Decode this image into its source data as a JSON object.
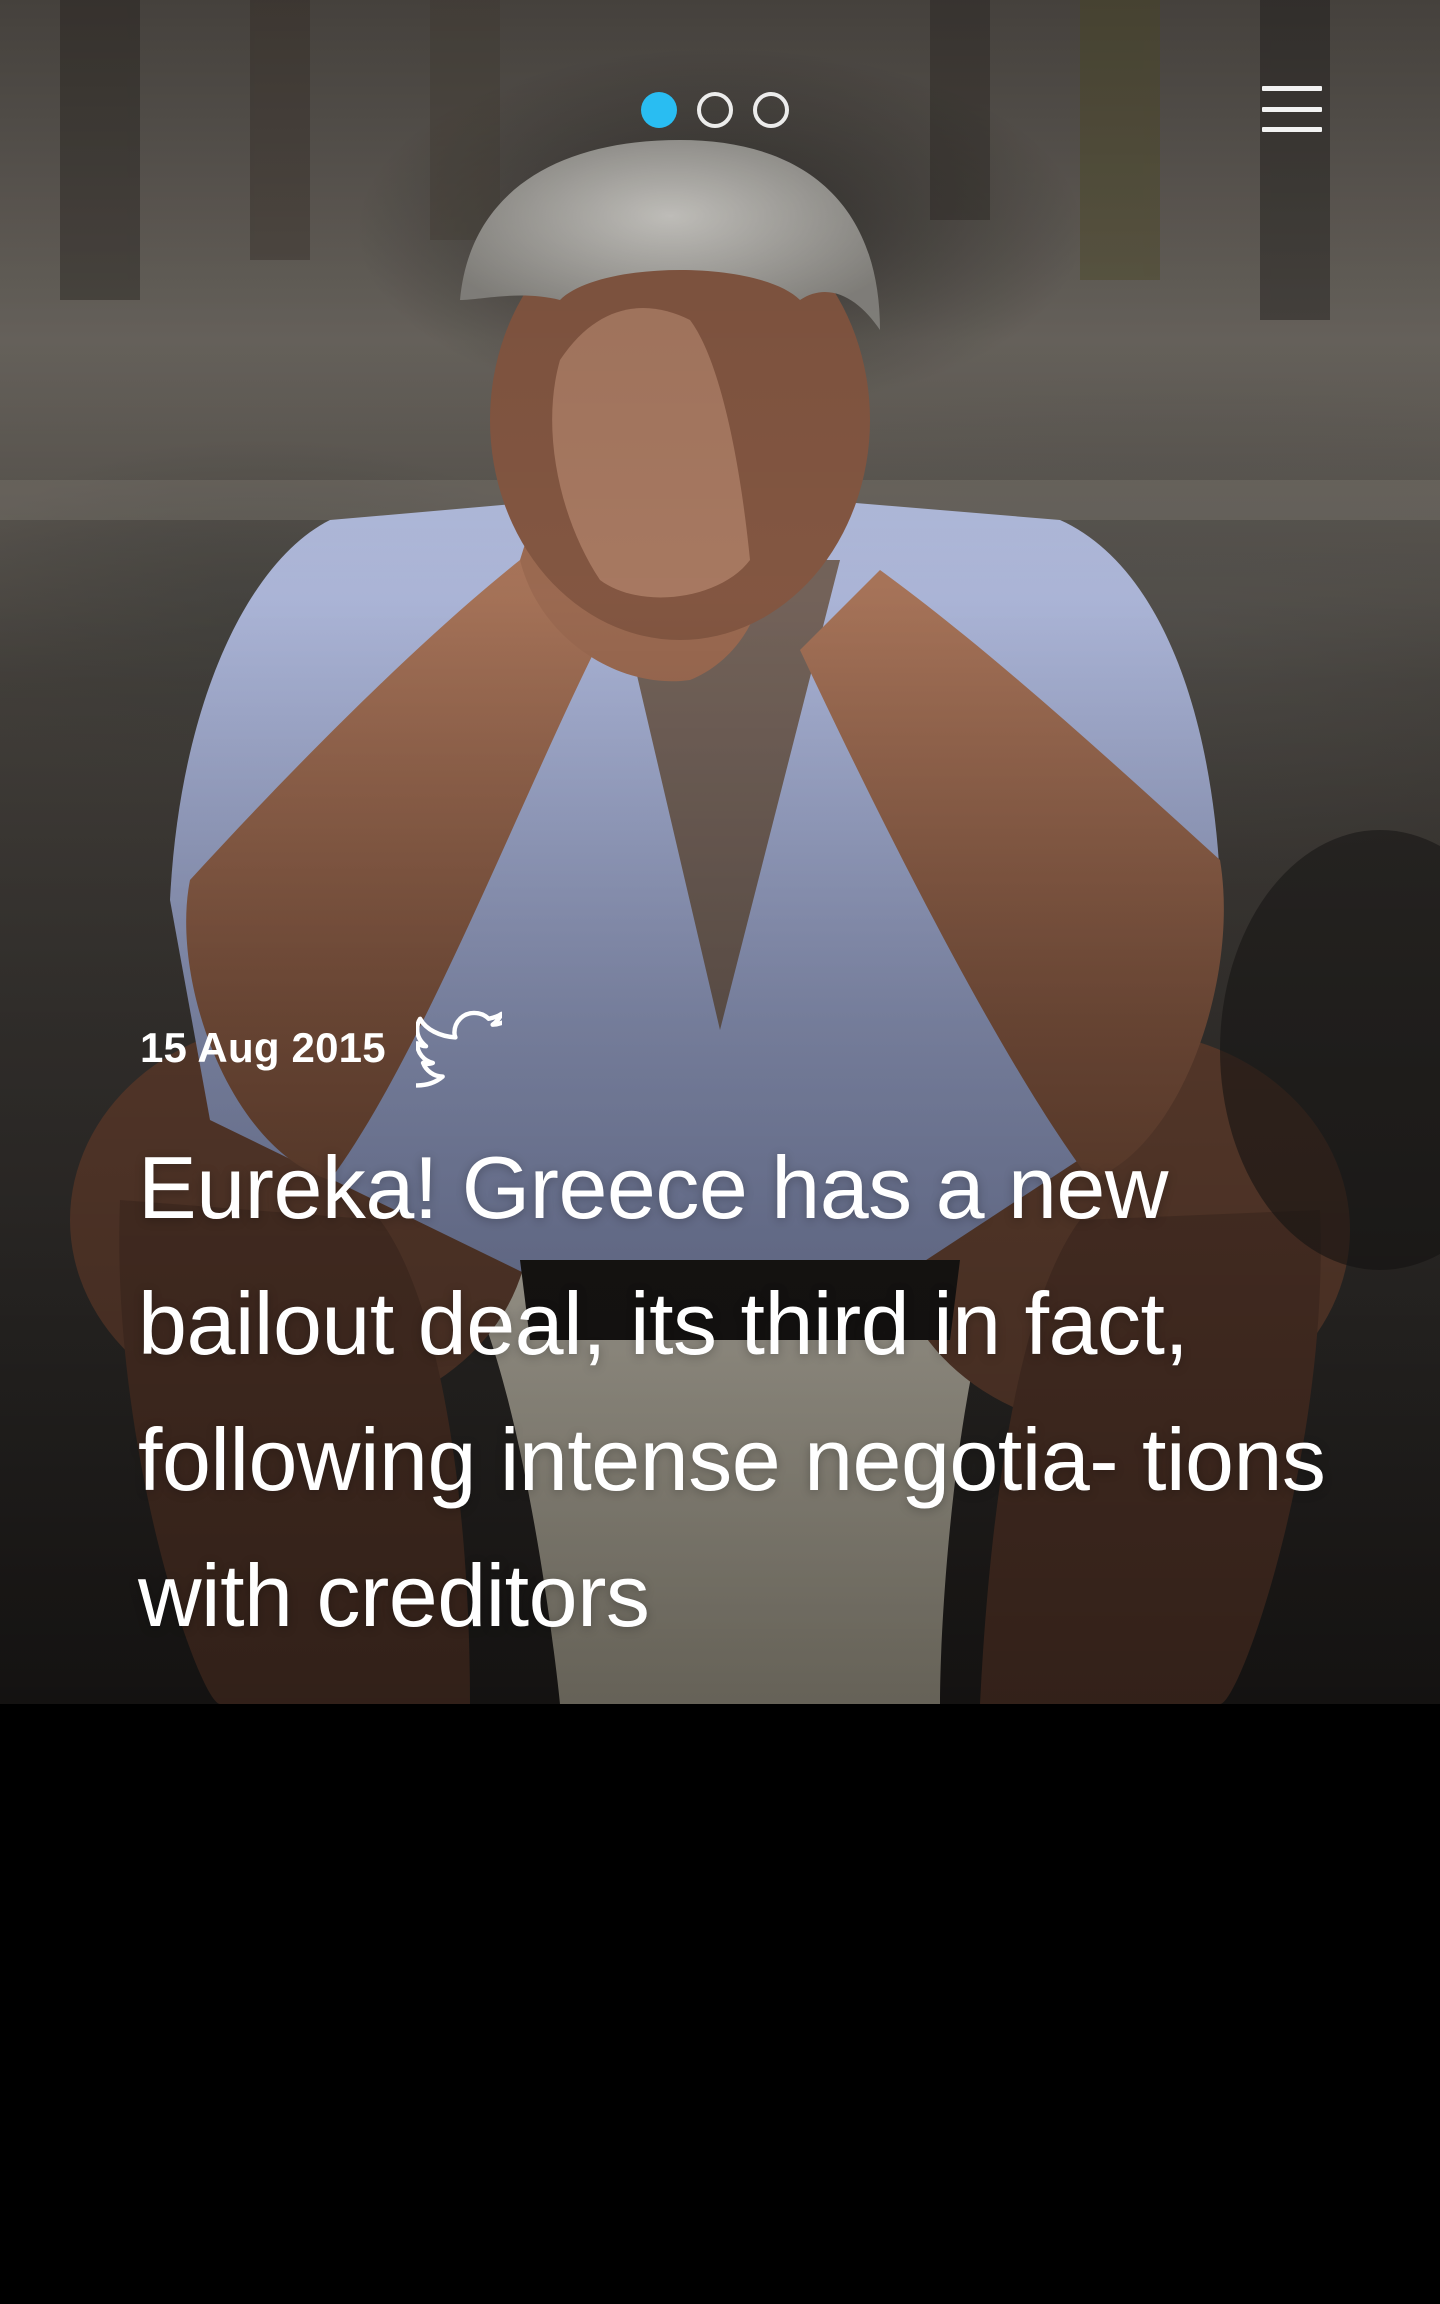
{
  "hero": {
    "image_alt": "Man with grey hair crouching with clasped hands pressed against his forehead",
    "date": "15 Aug 2015",
    "headline": "Eureka! Greece has a new bailout deal, its third in fact, following intense negotia- tions with creditors",
    "share_icon": "twitter-icon"
  },
  "pager": {
    "count": 3,
    "active_index": 0,
    "active_color": "#29bdf2"
  },
  "menu": {
    "icon": "hamburger-icon"
  },
  "colors": {
    "background": "#000000",
    "text": "#ffffff"
  }
}
